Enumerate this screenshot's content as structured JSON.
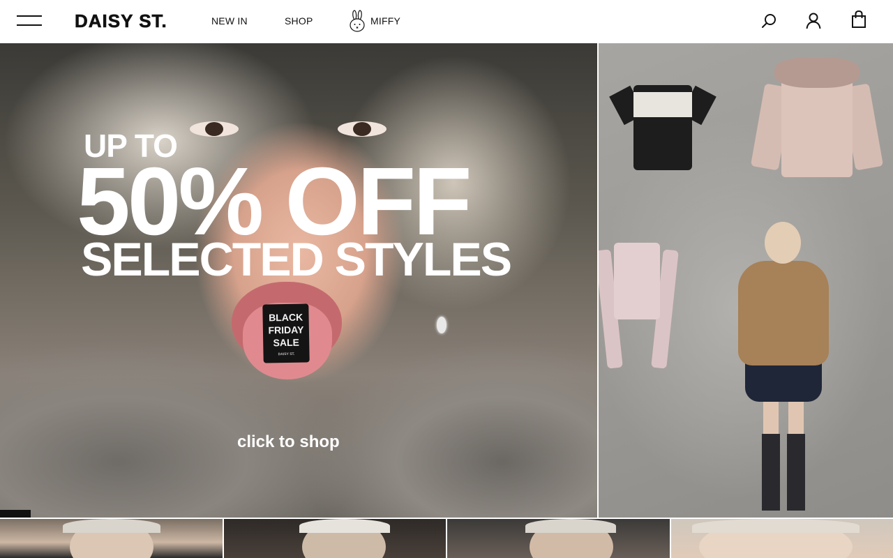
{
  "header": {
    "brand": "DAISY ST.",
    "nav": [
      {
        "label": "NEW IN"
      },
      {
        "label": "SHOP"
      },
      {
        "label": "MIFFY",
        "icon": "miffy-bunny-icon"
      }
    ],
    "icons": [
      "hamburger-menu-icon",
      "search-icon",
      "account-icon",
      "shopping-bag-icon"
    ]
  },
  "hero": {
    "promo_line1": "UP TO",
    "promo_line2": "50% OFF",
    "promo_line3": "SELECTED STYLES",
    "cta": "click to shop",
    "tag_lines": [
      "BLACK",
      "FRIDAY",
      "SALE"
    ],
    "tag_brand": "DAISY ST."
  },
  "colors": {
    "text": "#111111",
    "promo_text": "#ffffff",
    "background": "#ffffff",
    "slide_indicator": "#111111"
  }
}
